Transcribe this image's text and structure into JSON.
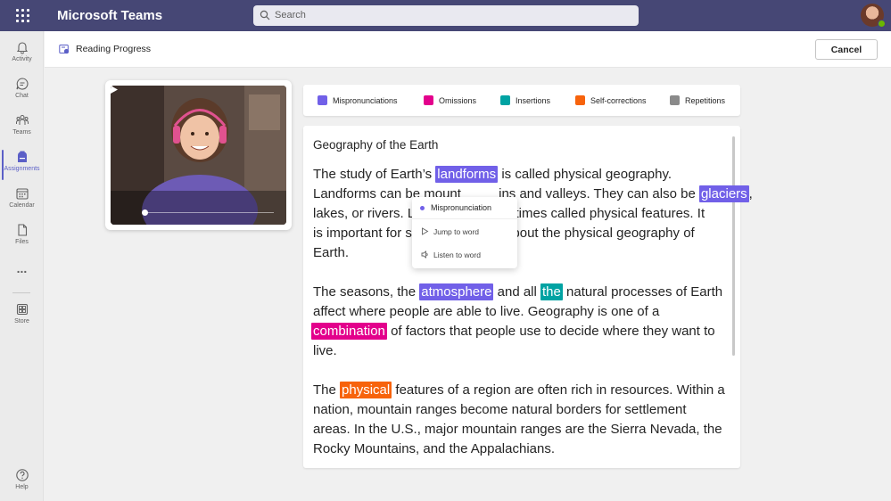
{
  "app": {
    "title": "Microsoft Teams"
  },
  "search": {
    "placeholder": "Search"
  },
  "rail": {
    "items": [
      {
        "label": "Activity",
        "icon": "bell-icon"
      },
      {
        "label": "Chat",
        "icon": "chat-icon"
      },
      {
        "label": "Teams",
        "icon": "teams-icon"
      },
      {
        "label": "Assignments",
        "icon": "backpack-icon",
        "active": true
      },
      {
        "label": "Calendar",
        "icon": "calendar-icon"
      },
      {
        "label": "Files",
        "icon": "file-icon"
      },
      {
        "label": "Store",
        "icon": "store-icon"
      },
      {
        "label": "Help",
        "icon": "help-icon"
      }
    ],
    "more": "..."
  },
  "header": {
    "title": "Reading Progress",
    "cancel_label": "Cancel"
  },
  "legend": {
    "items": [
      {
        "label": "Mispronunciations",
        "color": "#7160e8"
      },
      {
        "label": "Omissions",
        "color": "#e3008c"
      },
      {
        "label": "Insertions",
        "color": "#00a3a3"
      },
      {
        "label": "Self-corrections",
        "color": "#f7630c"
      },
      {
        "label": "Repetitions",
        "color": "#8a8a8a"
      }
    ]
  },
  "passage": {
    "title": "Geography of the Earth",
    "p1": {
      "l1_a": "The study of Earth’s",
      "l1_hl": "landforms",
      "l1_b": "is called physical geography.",
      "l2_a": "Landforms can be mount",
      "l2_b": "ins and valleys. They can also be",
      "l2_hl": "glaciers",
      "l2_c": ",",
      "l3_a": "lakes, or rivers. L",
      "l3_b": "netimes called physical features. It",
      "l4_a": "is important for s",
      "l4_b": "about the physical geography of",
      "l5": "Earth."
    },
    "p2": {
      "l1_a": "The seasons, the",
      "l1_hl1": "atmosphere",
      "l1_b": "and all",
      "l1_hl2": "the",
      "l1_c": "natural processes of Earth",
      "l2": "affect where people are able to live. Geography is one of a",
      "l3_hl": "combination",
      "l3_b": "of factors that people use to decide where they want to",
      "l4": "live."
    },
    "p3": {
      "l1_a": "The",
      "l1_hl": "physical",
      "l1_b": "features of a region are often rich in resources. Within a",
      "l2": "nation, mountain ranges become natural borders for settlement",
      "l3": "areas. In the U.S., major mountain ranges are the Sierra Nevada, the",
      "l4": "Rocky Mountains, and the Appalachians."
    }
  },
  "menu": {
    "header": "Mispronunciation",
    "items": [
      {
        "label": "Jump to word",
        "icon": "play-outline-icon"
      },
      {
        "label": "Listen to word",
        "icon": "speaker-icon"
      }
    ]
  }
}
